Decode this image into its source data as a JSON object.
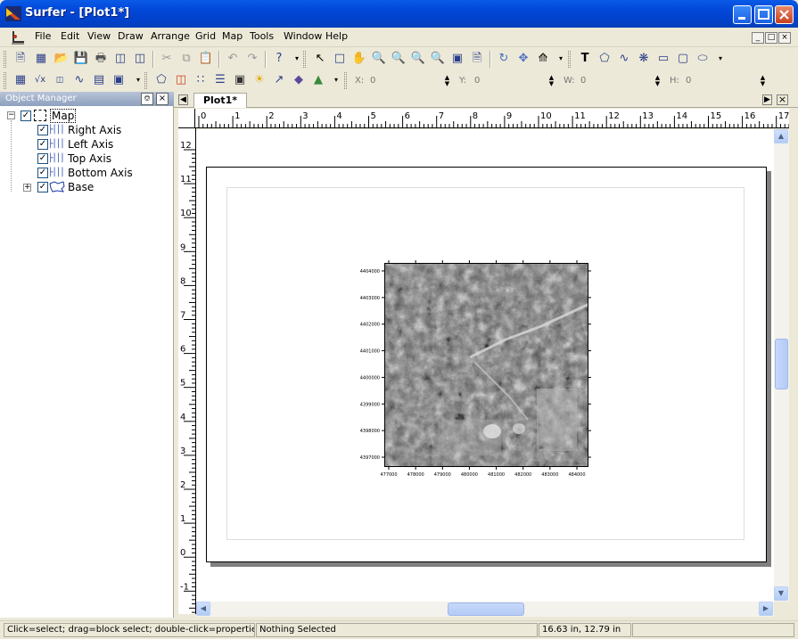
{
  "window": {
    "title": "Surfer - [Plot1*]"
  },
  "menu": [
    "File",
    "Edit",
    "View",
    "Draw",
    "Arrange",
    "Grid",
    "Map",
    "Tools",
    "Window",
    "Help"
  ],
  "coords": {
    "x_label": "X:",
    "x_value": "0",
    "y_label": "Y:",
    "y_value": "0",
    "w_label": "W:",
    "w_value": "0",
    "h_label": "H:",
    "h_value": "0"
  },
  "object_manager": {
    "title": "Object Manager",
    "root": {
      "label": "Map",
      "checked": true
    },
    "children": [
      {
        "label": "Right Axis",
        "checked": true,
        "icon": "axis-icon"
      },
      {
        "label": "Left Axis",
        "checked": true,
        "icon": "axis-icon"
      },
      {
        "label": "Top Axis",
        "checked": true,
        "icon": "axis-icon"
      },
      {
        "label": "Bottom Axis",
        "checked": true,
        "icon": "axis-icon"
      },
      {
        "label": "Base",
        "checked": true,
        "icon": "base-map-icon"
      }
    ]
  },
  "tabs": {
    "active": "Plot1*"
  },
  "rulers": {
    "horizontal": [
      "0",
      "1",
      "2",
      "3",
      "4",
      "5",
      "6",
      "7",
      "8",
      "9",
      "10",
      "11",
      "12",
      "13",
      "14",
      "15",
      "16",
      "17"
    ],
    "vertical": [
      "12",
      "11",
      "10",
      "9",
      "8",
      "7",
      "6",
      "5",
      "4",
      "3",
      "2",
      "1",
      "0",
      "-1"
    ]
  },
  "map": {
    "y_ticks": [
      "4404000",
      "4403000",
      "4402000",
      "4401000",
      "4400000",
      "4399000",
      "4398000",
      "4397000"
    ],
    "x_ticks": [
      "477000",
      "478000",
      "479000",
      "480000",
      "481000",
      "482000",
      "483000",
      "484000"
    ]
  },
  "status": {
    "hint": "Click=select; drag=block select; double-click=properties; s...",
    "selection": "Nothing Selected",
    "cursor": "16.63 in, 12.79 in"
  },
  "colors": {
    "titlebar": "#0146d6",
    "xp_face": "#ece9d8",
    "axis_icon": "#1838a8"
  }
}
